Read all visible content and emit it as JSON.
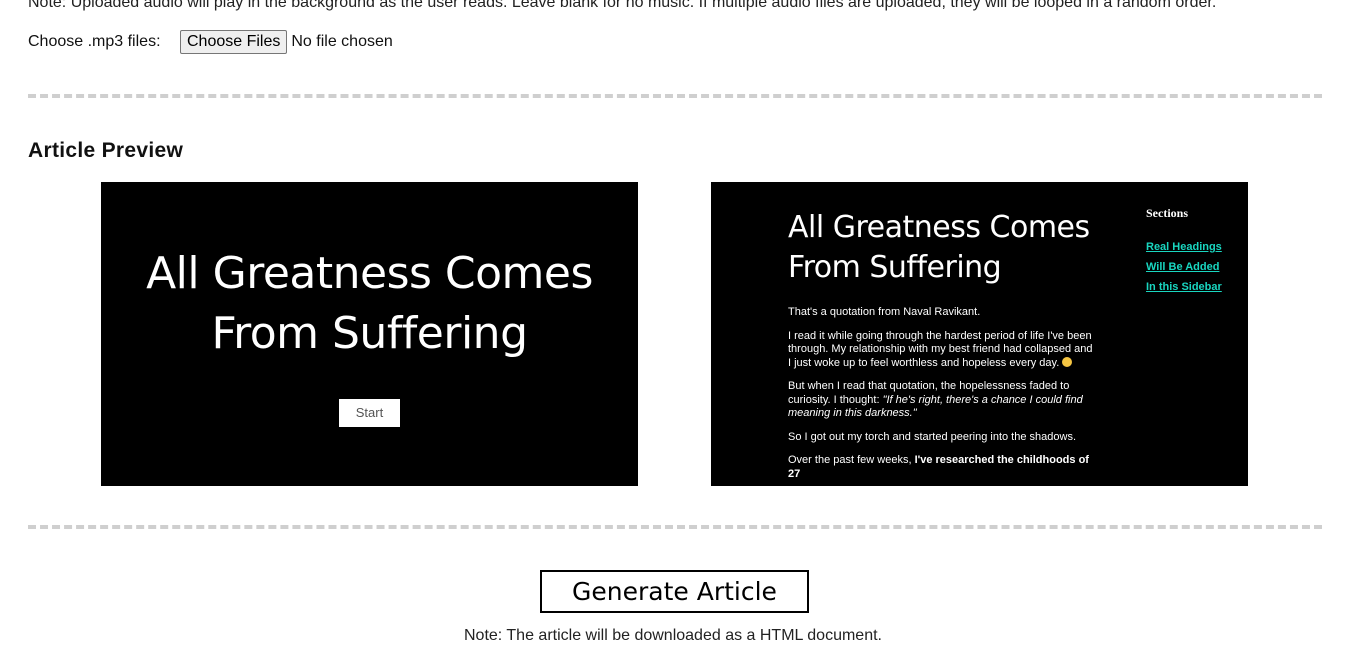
{
  "notes": {
    "top": "Note: Uploaded audio will play in the background as the user reads. Leave blank for no music. If multiple audio files are uploaded, they will be looped in a random order.",
    "bottom": "Note: The article will be downloaded as a HTML document."
  },
  "file_input": {
    "label": "Choose .mp3 files:",
    "button": "Choose Files",
    "status": "No file chosen"
  },
  "preview": {
    "heading": "Article Preview",
    "cover": {
      "title_line1": "All Greatness Comes",
      "title_line2": "From Suffering",
      "start_button": "Start"
    },
    "article": {
      "title_line1": "All Greatness Comes",
      "title_line2": "From Suffering",
      "p1": "That's a quotation from Naval Ravikant.",
      "p2": "I read it while going through the hardest period of life I've been through. My relationship with my best friend had collapsed and I just woke up to feel worthless and hopeless every day.",
      "p3_start": "But when I read that quotation, the hopelessness faded to curiosity. I thought: ",
      "p3_quote": "\"If he's right, there's a chance I could find meaning in this darkness.\"",
      "p4": "So I got out my torch and started peering into the shadows.",
      "p5_start": "Over the past few weeks, ",
      "p5_bold": "I've researched the childhoods of 27"
    },
    "sidebar": {
      "title": "Sections",
      "links": [
        "Real Headings",
        "Will Be Added",
        "In this Sidebar"
      ]
    }
  },
  "actions": {
    "generate": "Generate Article"
  },
  "colors": {
    "preview_bg": "#000000",
    "link": "#19d6c0",
    "divider": "#cfcfcf"
  }
}
